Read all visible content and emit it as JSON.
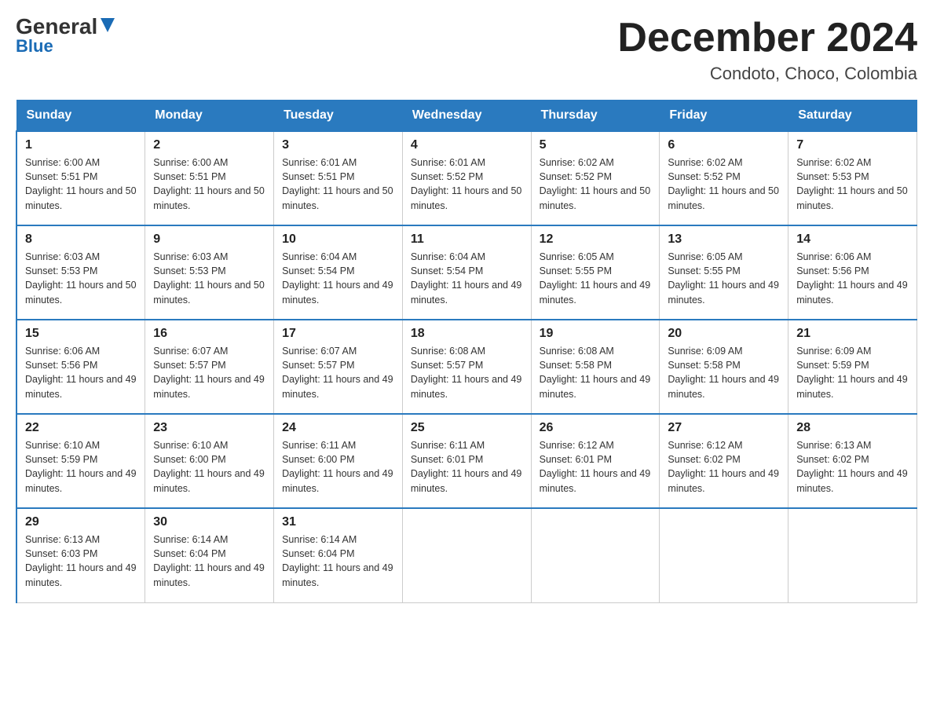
{
  "header": {
    "logo_general": "General",
    "logo_blue": "Blue",
    "month_title": "December 2024",
    "location": "Condoto, Choco, Colombia"
  },
  "days_of_week": [
    "Sunday",
    "Monday",
    "Tuesday",
    "Wednesday",
    "Thursday",
    "Friday",
    "Saturday"
  ],
  "weeks": [
    [
      {
        "day": "1",
        "sunrise": "6:00 AM",
        "sunset": "5:51 PM",
        "daylight": "11 hours and 50 minutes."
      },
      {
        "day": "2",
        "sunrise": "6:00 AM",
        "sunset": "5:51 PM",
        "daylight": "11 hours and 50 minutes."
      },
      {
        "day": "3",
        "sunrise": "6:01 AM",
        "sunset": "5:51 PM",
        "daylight": "11 hours and 50 minutes."
      },
      {
        "day": "4",
        "sunrise": "6:01 AM",
        "sunset": "5:52 PM",
        "daylight": "11 hours and 50 minutes."
      },
      {
        "day": "5",
        "sunrise": "6:02 AM",
        "sunset": "5:52 PM",
        "daylight": "11 hours and 50 minutes."
      },
      {
        "day": "6",
        "sunrise": "6:02 AM",
        "sunset": "5:52 PM",
        "daylight": "11 hours and 50 minutes."
      },
      {
        "day": "7",
        "sunrise": "6:02 AM",
        "sunset": "5:53 PM",
        "daylight": "11 hours and 50 minutes."
      }
    ],
    [
      {
        "day": "8",
        "sunrise": "6:03 AM",
        "sunset": "5:53 PM",
        "daylight": "11 hours and 50 minutes."
      },
      {
        "day": "9",
        "sunrise": "6:03 AM",
        "sunset": "5:53 PM",
        "daylight": "11 hours and 50 minutes."
      },
      {
        "day": "10",
        "sunrise": "6:04 AM",
        "sunset": "5:54 PM",
        "daylight": "11 hours and 49 minutes."
      },
      {
        "day": "11",
        "sunrise": "6:04 AM",
        "sunset": "5:54 PM",
        "daylight": "11 hours and 49 minutes."
      },
      {
        "day": "12",
        "sunrise": "6:05 AM",
        "sunset": "5:55 PM",
        "daylight": "11 hours and 49 minutes."
      },
      {
        "day": "13",
        "sunrise": "6:05 AM",
        "sunset": "5:55 PM",
        "daylight": "11 hours and 49 minutes."
      },
      {
        "day": "14",
        "sunrise": "6:06 AM",
        "sunset": "5:56 PM",
        "daylight": "11 hours and 49 minutes."
      }
    ],
    [
      {
        "day": "15",
        "sunrise": "6:06 AM",
        "sunset": "5:56 PM",
        "daylight": "11 hours and 49 minutes."
      },
      {
        "day": "16",
        "sunrise": "6:07 AM",
        "sunset": "5:57 PM",
        "daylight": "11 hours and 49 minutes."
      },
      {
        "day": "17",
        "sunrise": "6:07 AM",
        "sunset": "5:57 PM",
        "daylight": "11 hours and 49 minutes."
      },
      {
        "day": "18",
        "sunrise": "6:08 AM",
        "sunset": "5:57 PM",
        "daylight": "11 hours and 49 minutes."
      },
      {
        "day": "19",
        "sunrise": "6:08 AM",
        "sunset": "5:58 PM",
        "daylight": "11 hours and 49 minutes."
      },
      {
        "day": "20",
        "sunrise": "6:09 AM",
        "sunset": "5:58 PM",
        "daylight": "11 hours and 49 minutes."
      },
      {
        "day": "21",
        "sunrise": "6:09 AM",
        "sunset": "5:59 PM",
        "daylight": "11 hours and 49 minutes."
      }
    ],
    [
      {
        "day": "22",
        "sunrise": "6:10 AM",
        "sunset": "5:59 PM",
        "daylight": "11 hours and 49 minutes."
      },
      {
        "day": "23",
        "sunrise": "6:10 AM",
        "sunset": "6:00 PM",
        "daylight": "11 hours and 49 minutes."
      },
      {
        "day": "24",
        "sunrise": "6:11 AM",
        "sunset": "6:00 PM",
        "daylight": "11 hours and 49 minutes."
      },
      {
        "day": "25",
        "sunrise": "6:11 AM",
        "sunset": "6:01 PM",
        "daylight": "11 hours and 49 minutes."
      },
      {
        "day": "26",
        "sunrise": "6:12 AM",
        "sunset": "6:01 PM",
        "daylight": "11 hours and 49 minutes."
      },
      {
        "day": "27",
        "sunrise": "6:12 AM",
        "sunset": "6:02 PM",
        "daylight": "11 hours and 49 minutes."
      },
      {
        "day": "28",
        "sunrise": "6:13 AM",
        "sunset": "6:02 PM",
        "daylight": "11 hours and 49 minutes."
      }
    ],
    [
      {
        "day": "29",
        "sunrise": "6:13 AM",
        "sunset": "6:03 PM",
        "daylight": "11 hours and 49 minutes."
      },
      {
        "day": "30",
        "sunrise": "6:14 AM",
        "sunset": "6:04 PM",
        "daylight": "11 hours and 49 minutes."
      },
      {
        "day": "31",
        "sunrise": "6:14 AM",
        "sunset": "6:04 PM",
        "daylight": "11 hours and 49 minutes."
      },
      null,
      null,
      null,
      null
    ]
  ]
}
